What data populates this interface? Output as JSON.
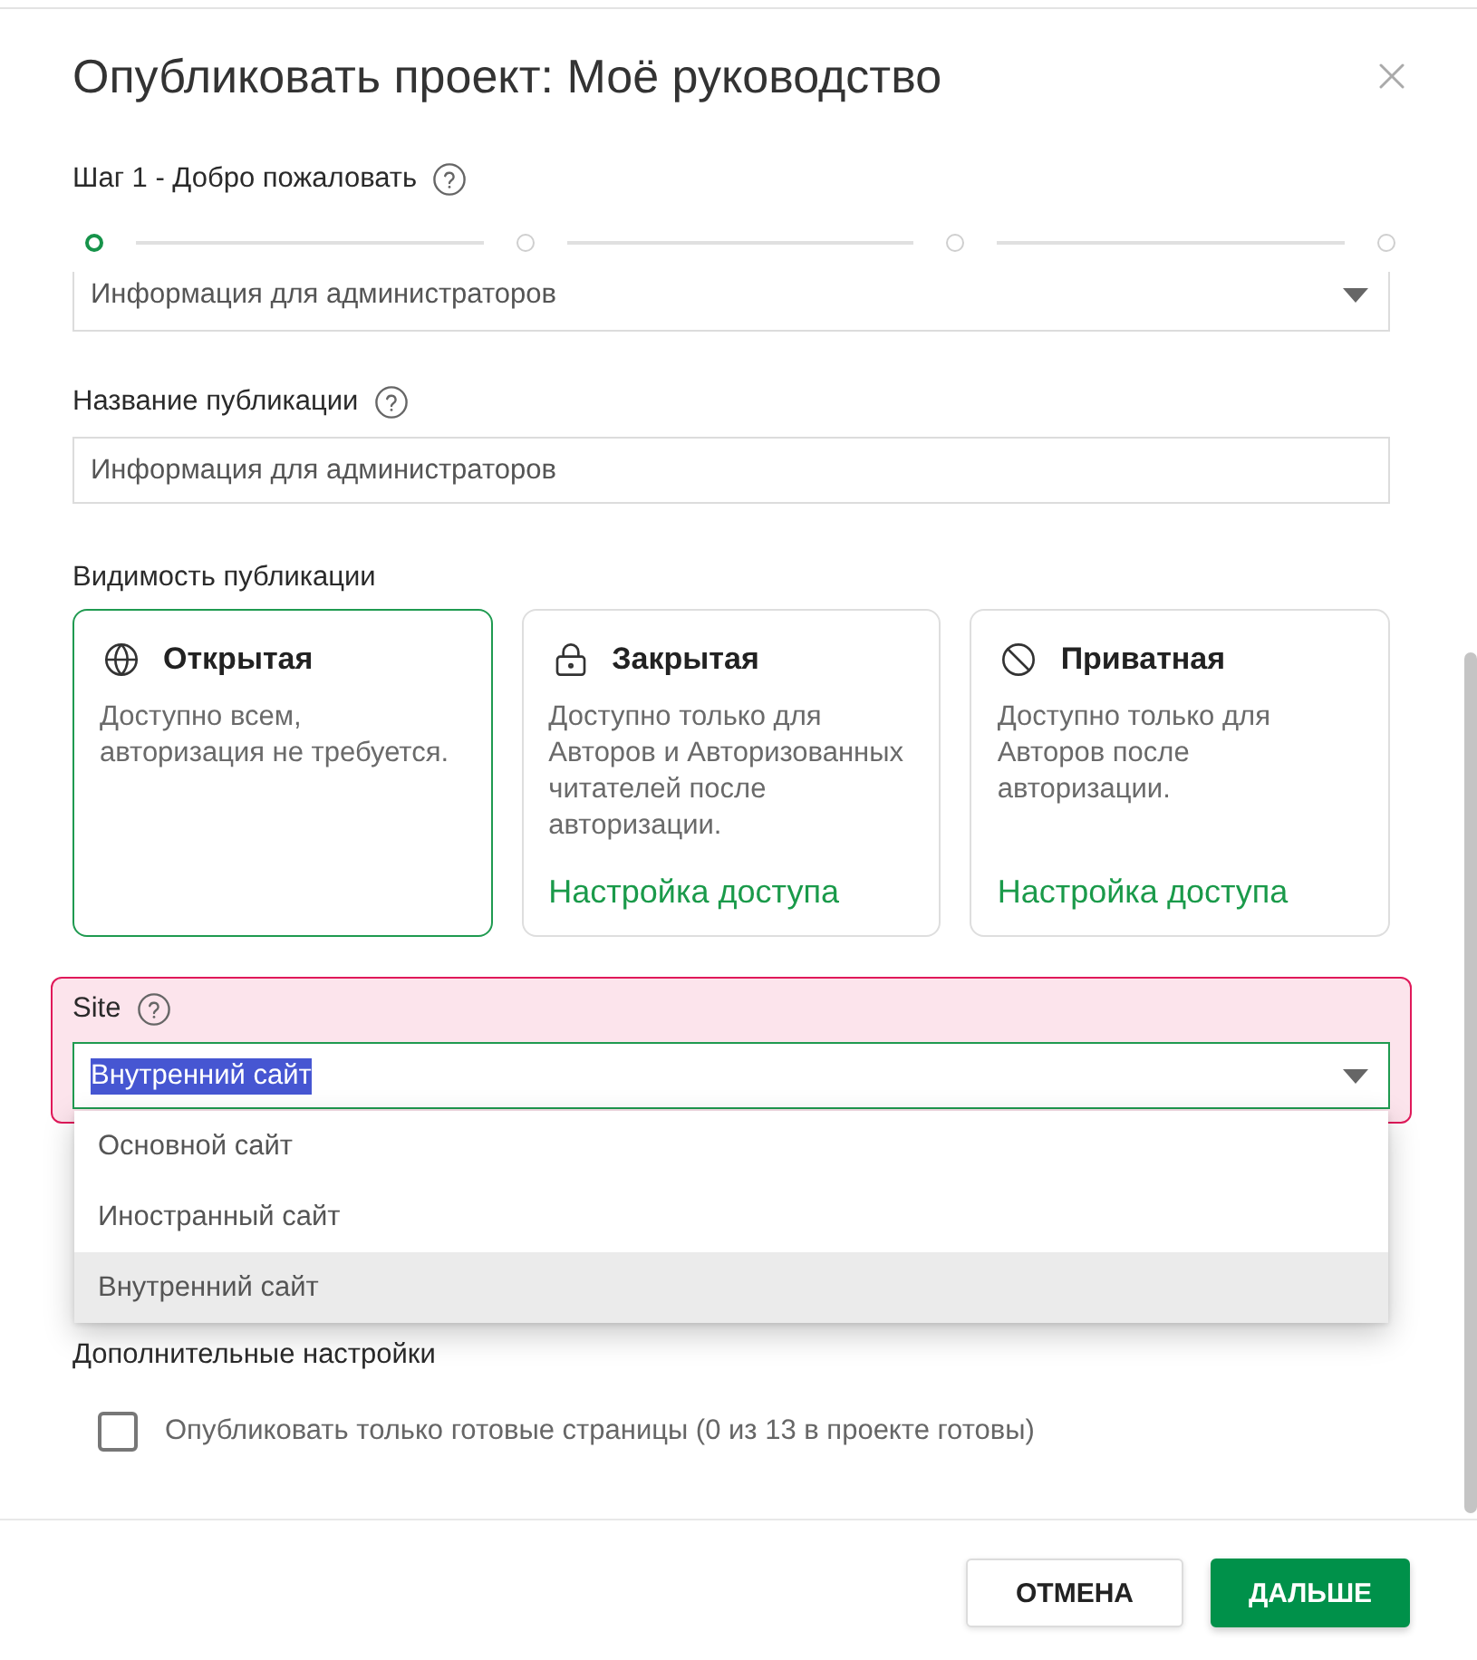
{
  "dialog": {
    "title": "Опубликовать проект: Моё руководство"
  },
  "step": {
    "label": "Шаг 1 - Добро пожаловать",
    "help": true,
    "stepper": [
      {
        "active": true
      },
      {
        "active": false
      },
      {
        "active": false
      },
      {
        "active": false
      }
    ]
  },
  "fields": [
    {
      "kind": "select",
      "value": "Информация для администраторов"
    },
    {
      "kind": "input",
      "label": "Название публикации",
      "help": true,
      "value": "Информация для администраторов"
    }
  ],
  "visibility": {
    "label": "Видимость публикации",
    "options": [
      {
        "kind": "public",
        "title": "Открытая",
        "description": "Доступно всем, авторизация не требуется.",
        "selected": true
      },
      {
        "kind": "restricted",
        "title": "Закрытая",
        "description": "Доступно только для Авторов и Авторизованных читателей после авторизации.",
        "link": "Настройка доступа",
        "selected": false
      },
      {
        "kind": "private",
        "title": "Приватная",
        "description": "Доступно только для Авторов после авторизации.",
        "link": "Настройка доступа",
        "selected": false
      }
    ]
  },
  "site": {
    "label": "Site",
    "help": true,
    "highlighted": true,
    "value": "Внутренний сайт",
    "value_selected": true,
    "open": true,
    "options": [
      {
        "label": "Основной сайт",
        "selected": false
      },
      {
        "label": "Иностранный сайт",
        "selected": false
      },
      {
        "label": "Внутренний сайт",
        "selected": true
      }
    ]
  },
  "advanced": {
    "label": "Дополнительные настройки",
    "checkbox": {
      "label": "Опубликовать только готовые страницы (0 из 13 в проекте готовы)",
      "checked": false
    }
  },
  "buttons": [
    {
      "label": "ОТМЕНА",
      "kind": "secondary"
    },
    {
      "label": "ДАЛЬШЕ",
      "kind": "primary"
    }
  ]
}
